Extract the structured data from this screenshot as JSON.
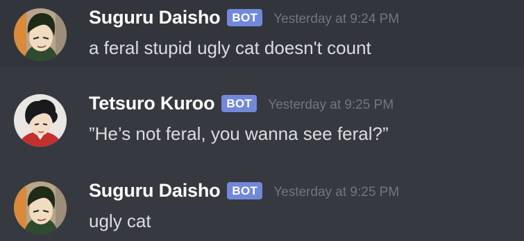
{
  "messages": [
    {
      "username": "Suguru Daisho",
      "tag": "BOT",
      "timestamp": "Yesterday at 9:24 PM",
      "text": "a feral stupid ugly cat doesn't count",
      "avatar": "suguru-daisho-avatar"
    },
    {
      "username": "Tetsuro Kuroo",
      "tag": "BOT",
      "timestamp": "Yesterday at 9:25 PM",
      "text": "”He’s not feral, you wanna see feral?”",
      "avatar": "tetsuro-kuroo-avatar"
    },
    {
      "username": "Suguru Daisho",
      "tag": "BOT",
      "timestamp": "Yesterday at 9:25 PM",
      "text": "ugly cat",
      "avatar": "suguru-daisho-avatar"
    }
  ],
  "colors": {
    "background": "#36393f",
    "hover_background": "#32353b",
    "bot_tag": "#7289da",
    "username": "#ffffff",
    "timestamp": "#72767d",
    "message_text": "#dcddde"
  }
}
